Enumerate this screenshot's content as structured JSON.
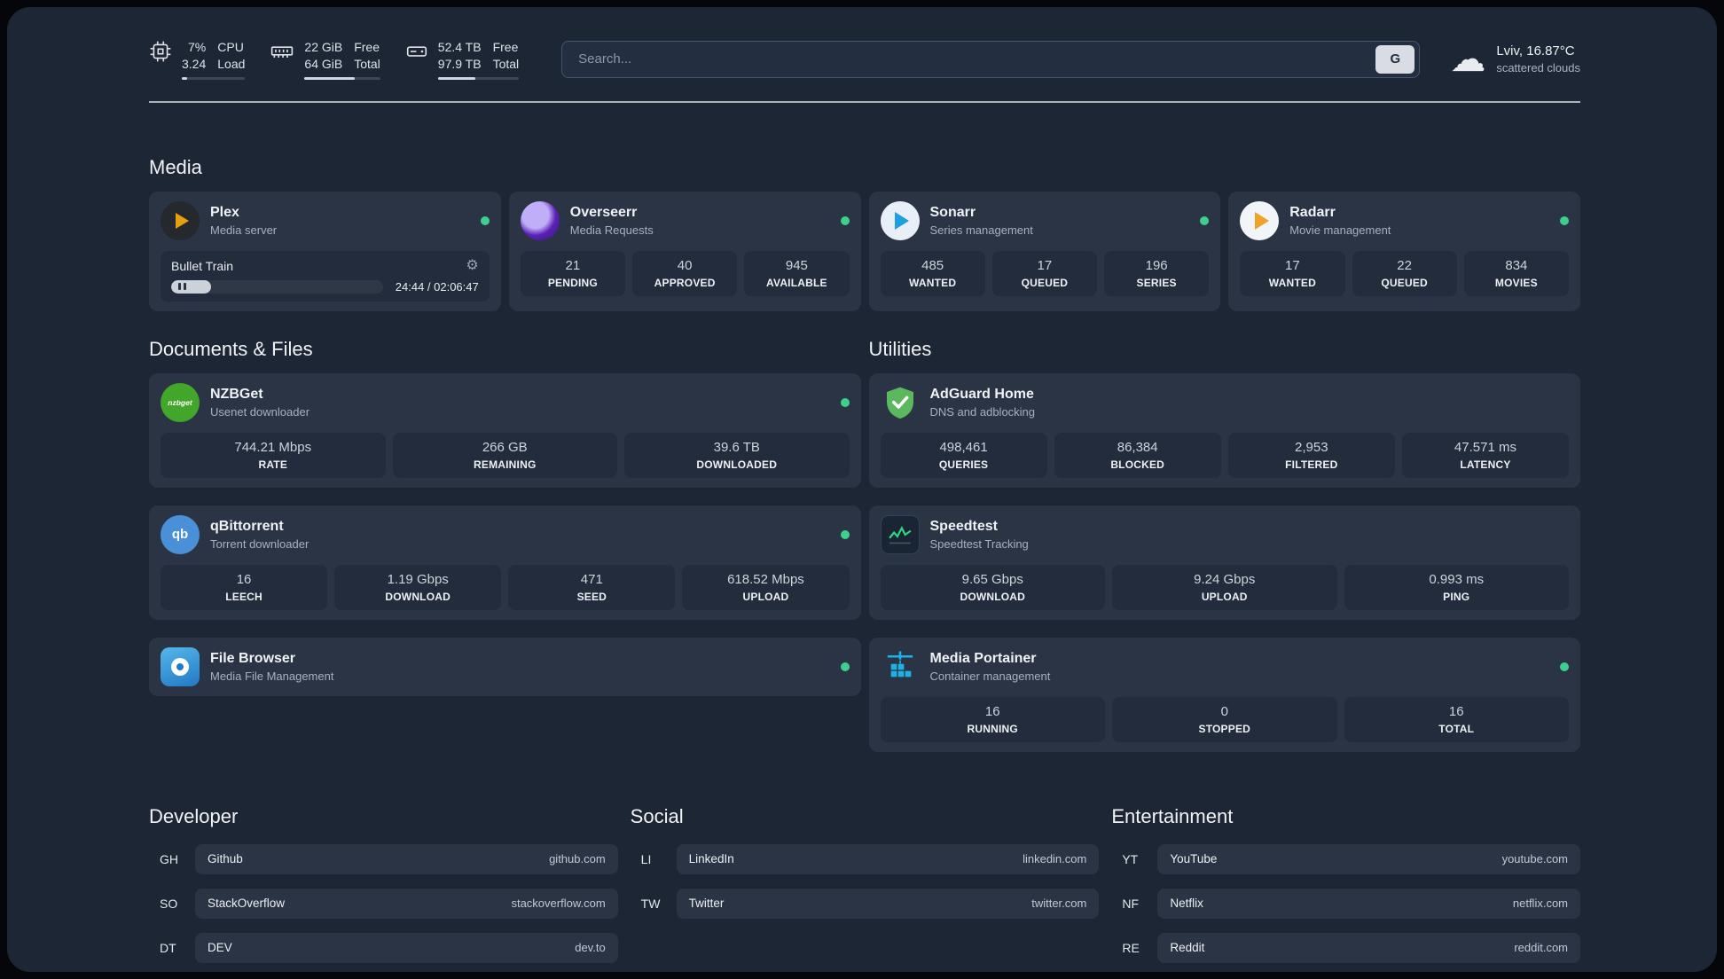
{
  "topbar": {
    "cpu": {
      "value1": "7%",
      "value2": "3.24",
      "label1": "CPU",
      "label2": "Load",
      "bar_style": "width:8%"
    },
    "memory": {
      "value1": "22 GiB",
      "value2": "64 GiB",
      "label1": "Free",
      "label2": "Total",
      "bar_style": "width:66%"
    },
    "disk": {
      "value1": "52.4 TB",
      "value2": "97.9 TB",
      "label1": "Free",
      "label2": "Total",
      "bar_style": "width:46%"
    },
    "search": {
      "placeholder": "Search...",
      "provider_label": "G"
    },
    "weather": {
      "location": "Lviv, 16.87°C",
      "condition": "scattered clouds"
    }
  },
  "icons": {
    "gear": "⚙",
    "cloud": "☁"
  },
  "colors": {
    "status_online": "#3ecf8e",
    "plex_accent": "#e5a00d",
    "page_bg": "#1d2634",
    "card_bg": "#2a3445"
  },
  "media": {
    "title": "Media",
    "plex": {
      "name": "Plex",
      "desc": "Media server",
      "player": {
        "title": "Bullet Train",
        "time": "24:44 / 02:06:47",
        "fill_style": "width:19%"
      }
    },
    "overseerr": {
      "name": "Overseerr",
      "desc": "Media Requests",
      "stats": [
        {
          "value": "21",
          "label": "PENDING"
        },
        {
          "value": "40",
          "label": "APPROVED"
        },
        {
          "value": "945",
          "label": "AVAILABLE"
        }
      ]
    },
    "sonarr": {
      "name": "Sonarr",
      "desc": "Series management",
      "stats": [
        {
          "value": "485",
          "label": "WANTED"
        },
        {
          "value": "17",
          "label": "QUEUED"
        },
        {
          "value": "196",
          "label": "SERIES"
        }
      ]
    },
    "radarr": {
      "name": "Radarr",
      "desc": "Movie management",
      "stats": [
        {
          "value": "17",
          "label": "WANTED"
        },
        {
          "value": "22",
          "label": "QUEUED"
        },
        {
          "value": "834",
          "label": "MOVIES"
        }
      ]
    }
  },
  "documents": {
    "title": "Documents & Files",
    "nzbget": {
      "name": "NZBGet",
      "desc": "Usenet downloader",
      "icon_text": "nzbget",
      "stats": [
        {
          "value": "744.21 Mbps",
          "label": "RATE"
        },
        {
          "value": "266 GB",
          "label": "REMAINING"
        },
        {
          "value": "39.6 TB",
          "label": "DOWNLOADED"
        }
      ]
    },
    "qbittorrent": {
      "name": "qBittorrent",
      "desc": "Torrent downloader",
      "icon_text": "qb",
      "stats": [
        {
          "value": "16",
          "label": "LEECH"
        },
        {
          "value": "1.19 Gbps",
          "label": "DOWNLOAD"
        },
        {
          "value": "471",
          "label": "SEED"
        },
        {
          "value": "618.52 Mbps",
          "label": "UPLOAD"
        }
      ]
    },
    "filebrowser": {
      "name": "File Browser",
      "desc": "Media File Management"
    }
  },
  "utilities": {
    "title": "Utilities",
    "adguard": {
      "name": "AdGuard Home",
      "desc": "DNS and adblocking",
      "stats": [
        {
          "value": "498,461",
          "label": "QUERIES"
        },
        {
          "value": "86,384",
          "label": "BLOCKED"
        },
        {
          "value": "2,953",
          "label": "FILTERED"
        },
        {
          "value": "47.571 ms",
          "label": "LATENCY"
        }
      ]
    },
    "speedtest": {
      "name": "Speedtest",
      "desc": "Speedtest Tracking",
      "stats": [
        {
          "value": "9.65 Gbps",
          "label": "DOWNLOAD"
        },
        {
          "value": "9.24 Gbps",
          "label": "UPLOAD"
        },
        {
          "value": "0.993 ms",
          "label": "PING"
        }
      ]
    },
    "portainer": {
      "name": "Media Portainer",
      "desc": "Container management",
      "stats": [
        {
          "value": "16",
          "label": "RUNNING"
        },
        {
          "value": "0",
          "label": "STOPPED"
        },
        {
          "value": "16",
          "label": "TOTAL"
        }
      ]
    }
  },
  "bookmarks": {
    "developer": {
      "title": "Developer",
      "items": [
        {
          "abbr": "GH",
          "name": "Github",
          "url": "github.com"
        },
        {
          "abbr": "SO",
          "name": "StackOverflow",
          "url": "stackoverflow.com"
        },
        {
          "abbr": "DT",
          "name": "DEV",
          "url": "dev.to"
        }
      ]
    },
    "social": {
      "title": "Social",
      "items": [
        {
          "abbr": "LI",
          "name": "LinkedIn",
          "url": "linkedin.com"
        },
        {
          "abbr": "TW",
          "name": "Twitter",
          "url": "twitter.com"
        }
      ]
    },
    "entertainment": {
      "title": "Entertainment",
      "items": [
        {
          "abbr": "YT",
          "name": "YouTube",
          "url": "youtube.com"
        },
        {
          "abbr": "NF",
          "name": "Netflix",
          "url": "netflix.com"
        },
        {
          "abbr": "RE",
          "name": "Reddit",
          "url": "reddit.com"
        }
      ]
    }
  }
}
